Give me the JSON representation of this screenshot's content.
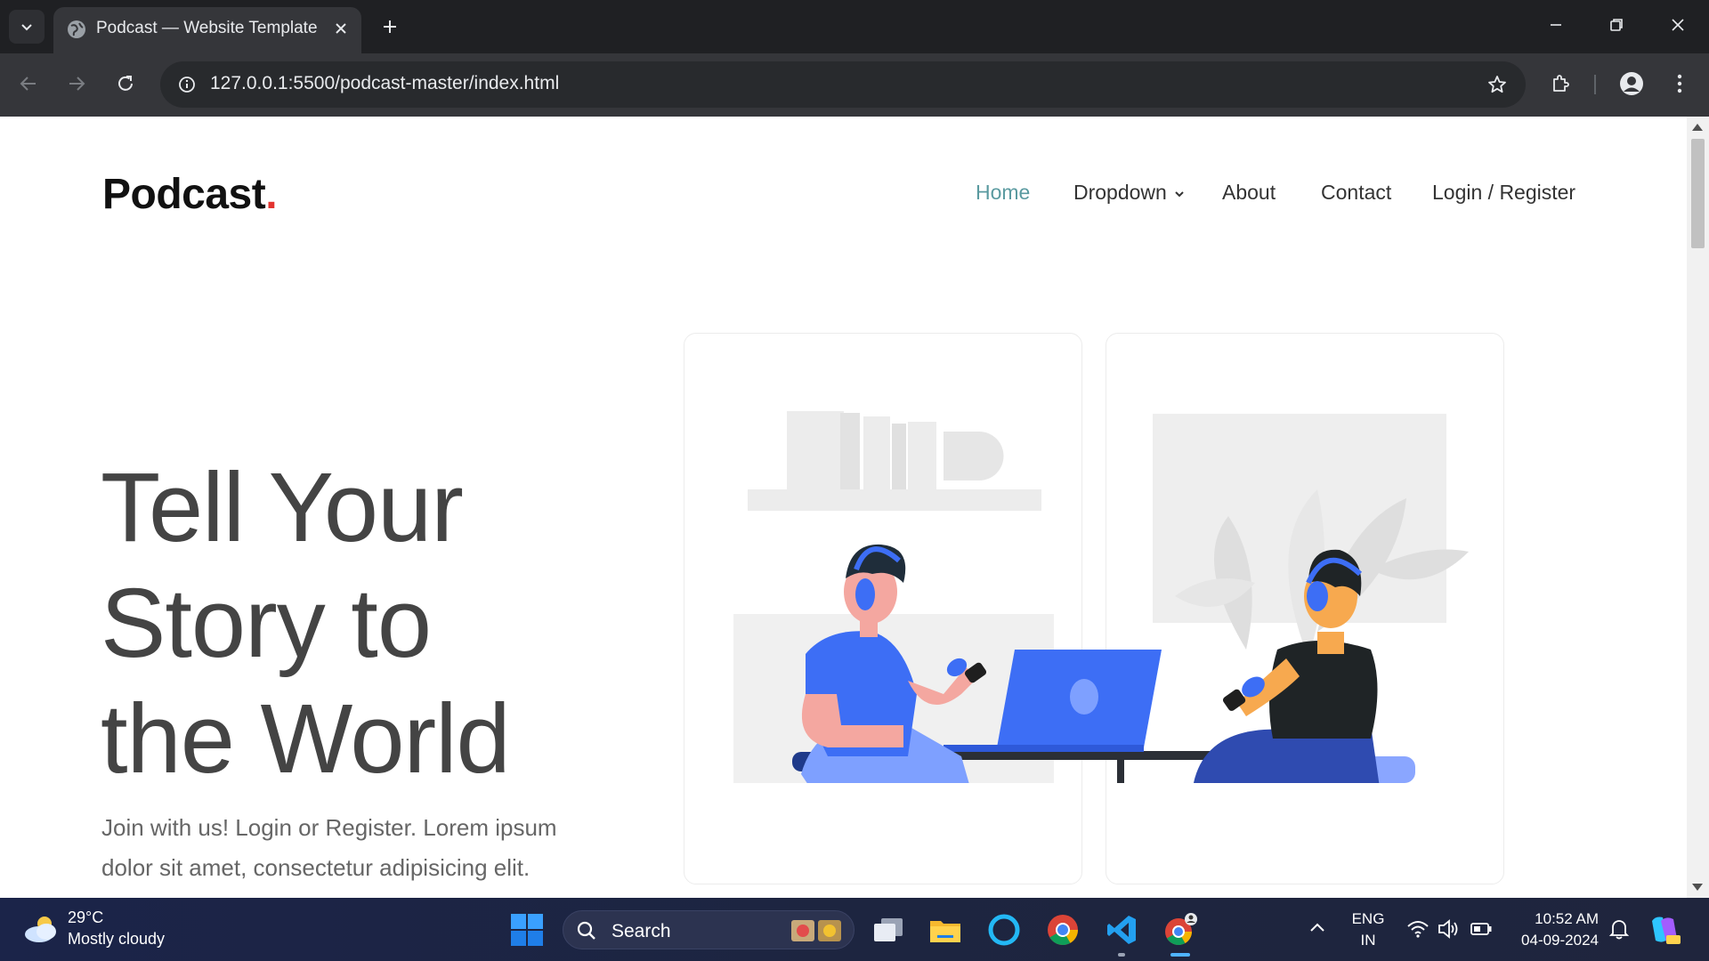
{
  "browser": {
    "tab_title": "Podcast — Website Template",
    "url": "127.0.0.1:5500/podcast-master/index.html"
  },
  "site": {
    "logo_text": "Podcast",
    "logo_dot": ".",
    "nav": [
      {
        "label": "Home",
        "active": true
      },
      {
        "label": "Dropdown"
      },
      {
        "label": "About"
      },
      {
        "label": "Contact"
      },
      {
        "label": "Login / Register"
      }
    ],
    "hero": {
      "title_line1": "Tell Your",
      "title_line2": "Story to",
      "title_line3": "the World",
      "subtitle": "Join with us! Login or Register. Lorem ipsum dolor sit amet, consectetur adipisicing elit."
    },
    "colors": {
      "accent_nav": "#5a9aa0",
      "logo_dot": "#e3342f",
      "illustration_blue": "#3d6ef5"
    }
  },
  "taskbar": {
    "weather_temp": "29°C",
    "weather_desc": "Mostly cloudy",
    "search_placeholder": "Search",
    "lang_line1": "ENG",
    "lang_line2": "IN",
    "time": "10:52 AM",
    "date": "04-09-2024",
    "apps": [
      "task-view",
      "file-explorer",
      "cortana",
      "chrome",
      "vscode",
      "chrome-profile"
    ]
  }
}
